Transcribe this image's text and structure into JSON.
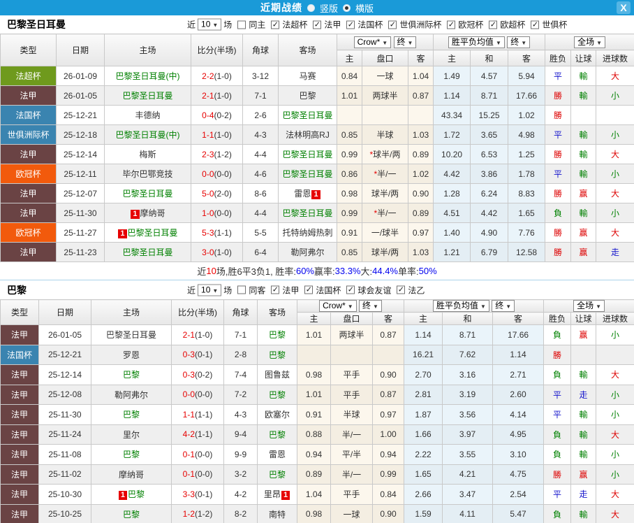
{
  "titlebar": {
    "title": "近期战绩",
    "vertical_label": "竖版",
    "horizontal_label": "横版",
    "close_label": "X"
  },
  "league_colors": {
    "法超杯": "#6f9a1d",
    "法甲": "#6a4344",
    "法国杯": "#3a84b0",
    "世俱洲际杯": "#3a84b0",
    "欧冠杯": "#f25a0c"
  },
  "mark_colors": {
    "勝": "#dd0000",
    "平": "#1414cc",
    "負": "#008000",
    "赢": "#dd0000",
    "輸": "#008000",
    "走": "#1414cc",
    "大": "#dd0000",
    "小": "#008000"
  },
  "sections": [
    {
      "team": "巴黎圣日耳曼",
      "filter": {
        "near": "近",
        "count": "10",
        "matches": "场",
        "same": "同主",
        "same_checked": false,
        "leagues": [
          "法超杯",
          "法甲",
          "法国杯",
          "世俱洲际杯",
          "欧冠杯",
          "欧超杯",
          "世俱杯"
        ]
      },
      "header": {
        "type": "类型",
        "date": "日期",
        "home": "主场",
        "score": "比分(半场)",
        "corners": "角球",
        "away": "客场",
        "odds_source": "Crow*",
        "final1": "终",
        "avg": "胜平负均值",
        "final2": "终",
        "scope": "全场",
        "sub": [
          "主",
          "盘口",
          "客",
          "主",
          "和",
          "客",
          "胜负",
          "让球",
          "进球数"
        ]
      },
      "rows": [
        {
          "league": "法超杯",
          "date": "26-01-09",
          "home": {
            "name": "巴黎圣日耳曼(中)",
            "hl": true
          },
          "score": "2-2",
          "half": "(1-0)",
          "corners": "3-12",
          "away": {
            "name": "马赛"
          },
          "odds": [
            "0.84",
            "一球",
            "1.04"
          ],
          "star": false,
          "avg": [
            "1.49",
            "4.57",
            "5.94"
          ],
          "marks": [
            "平",
            "輸",
            "大"
          ]
        },
        {
          "league": "法甲",
          "date": "26-01-05",
          "home": {
            "name": "巴黎圣日耳曼",
            "hl": true
          },
          "score": "2-1",
          "half": "(1-0)",
          "corners": "7-1",
          "away": {
            "name": "巴黎"
          },
          "odds": [
            "1.01",
            "两球半",
            "0.87"
          ],
          "star": false,
          "avg": [
            "1.14",
            "8.71",
            "17.66"
          ],
          "marks": [
            "勝",
            "輸",
            "小"
          ]
        },
        {
          "league": "法国杯",
          "date": "25-12-21",
          "home": {
            "name": "丰德纳"
          },
          "score": "0-4",
          "half": "(0-2)",
          "corners": "2-6",
          "away": {
            "name": "巴黎圣日耳曼",
            "hl": true
          },
          "odds": [
            "",
            "",
            ""
          ],
          "star": false,
          "avg": [
            "43.34",
            "15.25",
            "1.02"
          ],
          "marks": [
            "勝",
            "",
            ""
          ]
        },
        {
          "league": "世俱洲际杯",
          "date": "25-12-18",
          "home": {
            "name": "巴黎圣日耳曼(中)",
            "hl": true
          },
          "score": "1-1",
          "half": "(1-0)",
          "corners": "4-3",
          "away": {
            "name": "法林明高RJ"
          },
          "odds": [
            "0.85",
            "半球",
            "1.03"
          ],
          "star": false,
          "avg": [
            "1.72",
            "3.65",
            "4.98"
          ],
          "marks": [
            "平",
            "輸",
            "小"
          ]
        },
        {
          "league": "法甲",
          "date": "25-12-14",
          "home": {
            "name": "梅斯"
          },
          "score": "2-3",
          "half": "(1-2)",
          "corners": "4-4",
          "away": {
            "name": "巴黎圣日耳曼",
            "hl": true
          },
          "odds": [
            "0.99",
            "球半/两",
            "0.89"
          ],
          "star": true,
          "avg": [
            "10.20",
            "6.53",
            "1.25"
          ],
          "marks": [
            "勝",
            "輸",
            "大"
          ]
        },
        {
          "league": "欧冠杯",
          "date": "25-12-11",
          "home": {
            "name": "毕尔巴鄂竞技"
          },
          "score": "0-0",
          "half": "(0-0)",
          "corners": "4-6",
          "away": {
            "name": "巴黎圣日耳曼",
            "hl": true
          },
          "odds": [
            "0.86",
            "半/一",
            "1.02"
          ],
          "star": true,
          "avg": [
            "4.42",
            "3.86",
            "1.78"
          ],
          "marks": [
            "平",
            "輸",
            "小"
          ]
        },
        {
          "league": "法甲",
          "date": "25-12-07",
          "home": {
            "name": "巴黎圣日耳曼",
            "hl": true
          },
          "score": "5-0",
          "half": "(2-0)",
          "corners": "8-6",
          "away": {
            "name": "雷恩",
            "badge": "1",
            "badge_pos": "after"
          },
          "odds": [
            "0.98",
            "球半/两",
            "0.90"
          ],
          "star": false,
          "avg": [
            "1.28",
            "6.24",
            "8.83"
          ],
          "marks": [
            "勝",
            "赢",
            "大"
          ]
        },
        {
          "league": "法甲",
          "date": "25-11-30",
          "home": {
            "name": "摩纳哥",
            "badge": "1",
            "badge_pos": "before"
          },
          "score": "1-0",
          "half": "(0-0)",
          "corners": "4-4",
          "away": {
            "name": "巴黎圣日耳曼",
            "hl": true
          },
          "odds": [
            "0.99",
            "半/一",
            "0.89"
          ],
          "star": true,
          "avg": [
            "4.51",
            "4.42",
            "1.65"
          ],
          "marks": [
            "負",
            "輸",
            "小"
          ]
        },
        {
          "league": "欧冠杯",
          "date": "25-11-27",
          "home": {
            "name": "巴黎圣日耳曼",
            "hl": true,
            "badge": "1",
            "badge_pos": "before"
          },
          "score": "5-3",
          "half": "(1-1)",
          "corners": "5-5",
          "away": {
            "name": "托特纳姆热刺"
          },
          "odds": [
            "0.91",
            "一/球半",
            "0.97"
          ],
          "star": false,
          "avg": [
            "1.40",
            "4.90",
            "7.76"
          ],
          "marks": [
            "勝",
            "赢",
            "大"
          ]
        },
        {
          "league": "法甲",
          "date": "25-11-23",
          "home": {
            "name": "巴黎圣日耳曼",
            "hl": true
          },
          "score": "3-0",
          "half": "(1-0)",
          "corners": "6-4",
          "away": {
            "name": "勒阿弗尔"
          },
          "odds": [
            "0.85",
            "球半/两",
            "1.03"
          ],
          "star": false,
          "avg": [
            "1.21",
            "6.79",
            "12.58"
          ],
          "marks": [
            "勝",
            "赢",
            "走"
          ]
        }
      ],
      "summary": [
        [
          "近",
          "#333333"
        ],
        [
          "10",
          "#ee0000"
        ],
        [
          "场,胜6平3负1, 胜率:",
          "#333333"
        ],
        [
          "60%",
          "#0000ee"
        ],
        [
          " 赢率:",
          "#333333"
        ],
        [
          "33.3%",
          "#0000ee"
        ],
        [
          " 大:",
          "#333333"
        ],
        [
          "44.4%",
          "#0000ee"
        ],
        [
          " 单率:",
          "#333333"
        ],
        [
          "50%",
          "#0000ee"
        ]
      ]
    },
    {
      "team": "巴黎",
      "filter": {
        "near": "近",
        "count": "10",
        "matches": "场",
        "same": "同客",
        "same_checked": false,
        "leagues": [
          "法甲",
          "法国杯",
          "球会友谊",
          "法乙"
        ]
      },
      "header": {
        "type": "类型",
        "date": "日期",
        "home": "主场",
        "score": "比分(半场)",
        "corners": "角球",
        "away": "客场",
        "odds_source": "Crow*",
        "final1": "终",
        "avg": "胜平负均值",
        "final2": "终",
        "scope": "全场",
        "sub": [
          "主",
          "盘口",
          "客",
          "主",
          "和",
          "客",
          "胜负",
          "让球",
          "进球数"
        ]
      },
      "rows": [
        {
          "league": "法甲",
          "date": "26-01-05",
          "home": {
            "name": "巴黎圣日耳曼"
          },
          "score": "2-1",
          "half": "(1-0)",
          "corners": "7-1",
          "away": {
            "name": "巴黎",
            "hl": true
          },
          "odds": [
            "1.01",
            "两球半",
            "0.87"
          ],
          "star": false,
          "avg": [
            "1.14",
            "8.71",
            "17.66"
          ],
          "marks": [
            "負",
            "赢",
            "小"
          ]
        },
        {
          "league": "法国杯",
          "date": "25-12-21",
          "home": {
            "name": "罗恩"
          },
          "score": "0-3",
          "half": "(0-1)",
          "corners": "2-8",
          "away": {
            "name": "巴黎",
            "hl": true
          },
          "odds": [
            "",
            "",
            ""
          ],
          "star": false,
          "avg": [
            "16.21",
            "7.62",
            "1.14"
          ],
          "marks": [
            "勝",
            "",
            ""
          ]
        },
        {
          "league": "法甲",
          "date": "25-12-14",
          "home": {
            "name": "巴黎",
            "hl": true
          },
          "score": "0-3",
          "half": "(0-2)",
          "corners": "7-4",
          "away": {
            "name": "图鲁兹"
          },
          "odds": [
            "0.98",
            "平手",
            "0.90"
          ],
          "star": false,
          "avg": [
            "2.70",
            "3.16",
            "2.71"
          ],
          "marks": [
            "負",
            "輸",
            "大"
          ]
        },
        {
          "league": "法甲",
          "date": "25-12-08",
          "home": {
            "name": "勒阿弗尔"
          },
          "score": "0-0",
          "half": "(0-0)",
          "corners": "7-2",
          "away": {
            "name": "巴黎",
            "hl": true
          },
          "odds": [
            "1.01",
            "平手",
            "0.87"
          ],
          "star": false,
          "avg": [
            "2.81",
            "3.19",
            "2.60"
          ],
          "marks": [
            "平",
            "走",
            "小"
          ]
        },
        {
          "league": "法甲",
          "date": "25-11-30",
          "home": {
            "name": "巴黎",
            "hl": true
          },
          "score": "1-1",
          "half": "(1-1)",
          "corners": "4-3",
          "away": {
            "name": "欧塞尔"
          },
          "odds": [
            "0.91",
            "半球",
            "0.97"
          ],
          "star": false,
          "avg": [
            "1.87",
            "3.56",
            "4.14"
          ],
          "marks": [
            "平",
            "輸",
            "小"
          ]
        },
        {
          "league": "法甲",
          "date": "25-11-24",
          "home": {
            "name": "里尔"
          },
          "score": "4-2",
          "half": "(1-1)",
          "corners": "9-4",
          "away": {
            "name": "巴黎",
            "hl": true
          },
          "odds": [
            "0.88",
            "半/一",
            "1.00"
          ],
          "star": false,
          "avg": [
            "1.66",
            "3.97",
            "4.95"
          ],
          "marks": [
            "負",
            "輸",
            "大"
          ]
        },
        {
          "league": "法甲",
          "date": "25-11-08",
          "home": {
            "name": "巴黎",
            "hl": true
          },
          "score": "0-1",
          "half": "(0-0)",
          "corners": "9-9",
          "away": {
            "name": "雷恩"
          },
          "odds": [
            "0.94",
            "平/半",
            "0.94"
          ],
          "star": false,
          "avg": [
            "2.22",
            "3.55",
            "3.10"
          ],
          "marks": [
            "負",
            "輸",
            "小"
          ]
        },
        {
          "league": "法甲",
          "date": "25-11-02",
          "home": {
            "name": "摩纳哥"
          },
          "score": "0-1",
          "half": "(0-0)",
          "corners": "3-2",
          "away": {
            "name": "巴黎",
            "hl": true
          },
          "odds": [
            "0.89",
            "半/一",
            "0.99"
          ],
          "star": false,
          "avg": [
            "1.65",
            "4.21",
            "4.75"
          ],
          "marks": [
            "勝",
            "赢",
            "小"
          ]
        },
        {
          "league": "法甲",
          "date": "25-10-30",
          "home": {
            "name": "巴黎",
            "hl": true,
            "badge": "1",
            "badge_pos": "before"
          },
          "score": "3-3",
          "half": "(0-1)",
          "corners": "4-2",
          "away": {
            "name": "里昂",
            "badge": "1",
            "badge_pos": "after"
          },
          "odds": [
            "1.04",
            "平手",
            "0.84"
          ],
          "star": false,
          "avg": [
            "2.66",
            "3.47",
            "2.54"
          ],
          "marks": [
            "平",
            "走",
            "大"
          ]
        },
        {
          "league": "法甲",
          "date": "25-10-25",
          "home": {
            "name": "巴黎",
            "hl": true
          },
          "score": "1-2",
          "half": "(1-2)",
          "corners": "8-2",
          "away": {
            "name": "南特"
          },
          "odds": [
            "0.98",
            "一球",
            "0.90"
          ],
          "star": false,
          "avg": [
            "1.59",
            "4.11",
            "5.47"
          ],
          "marks": [
            "負",
            "輸",
            "大"
          ]
        }
      ]
    }
  ]
}
